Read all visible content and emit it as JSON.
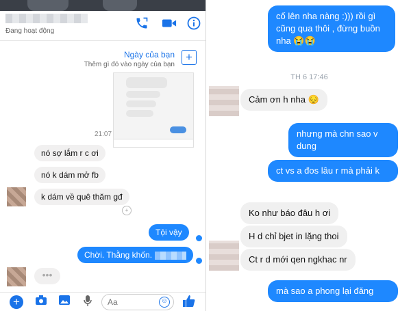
{
  "left": {
    "header": {
      "status": "Đang hoạt động",
      "icons": [
        "phone-icon",
        "video-icon",
        "info-icon"
      ]
    },
    "day_card": {
      "title": "Ngày của bạn",
      "subtitle": "Thêm gì đó vào ngày của bạn"
    },
    "time": "21:07",
    "messages_in": [
      "nó sợ lắm r c ơi",
      "nó k dám mở fb",
      "k dám về quê thăm gđ"
    ],
    "messages_out": [
      "Tội vậy",
      "Chời. Thằng khốn."
    ],
    "composer": {
      "placeholder": "Aa",
      "icons": [
        "plus-icon",
        "camera-icon",
        "image-icon",
        "mic-icon",
        "emoji-icon",
        "like-icon"
      ]
    },
    "colors": {
      "accent": "#1e88ff",
      "icon": "#1a73e8"
    }
  },
  "right": {
    "top_bubble": "cố lên nha nàng :))) rồi gì cũng qua thôi , đừng buồn nha 😭😭",
    "time": "TH 6 17:46",
    "msg_thanks": "Cảm ơn h nha 😔",
    "out_1": "nhưng mà chn sao v dung",
    "out_2": "ct vs a đos lâu r mà phải k",
    "in_1": "Ko như báo đâu h ơi",
    "in_2": "H d chỉ bjet in lặng thoi",
    "in_3": "Ct r d mới qen ngkhac nr",
    "out_3": "mà sao a phong lại đăng"
  }
}
